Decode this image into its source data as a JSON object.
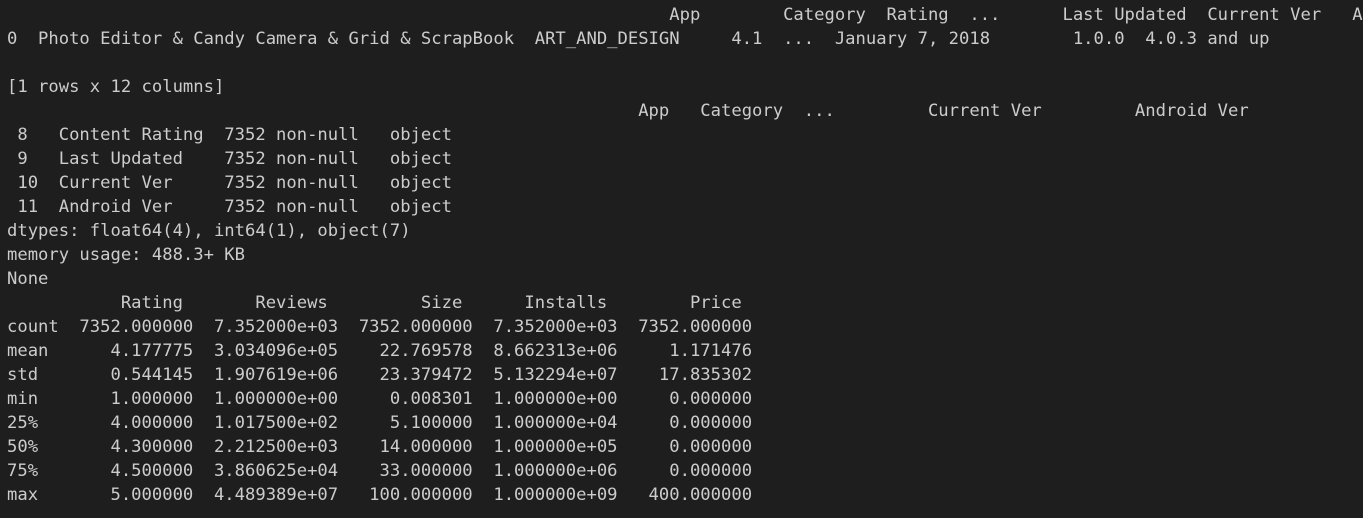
{
  "terminal": {
    "lines": [
      "                                                                App        Category  Rating  ...      Last Updated  Current Ver   Android Ver",
      "0  Photo Editor & Candy Camera & Grid & ScrapBook  ART_AND_DESIGN     4.1  ...  January 7, 2018        1.0.0  4.0.3 and up",
      "",
      "[1 rows x 12 columns]",
      "                                                             App   Category  ...         Current Ver         Android Ver",
      " 8   Content Rating  7352 non-null   object ",
      " 9   Last Updated    7352 non-null   object ",
      " 10  Current Ver     7352 non-null   object ",
      " 11  Android Ver     7352 non-null   object ",
      "dtypes: float64(4), int64(1), object(7)",
      "memory usage: 488.3+ KB",
      "None",
      "           Rating       Reviews         Size      Installs        Price",
      "count  7352.000000  7.352000e+03  7352.000000  7.352000e+03  7352.000000",
      "mean      4.177775  3.034096e+05    22.769578  8.662313e+06     1.171476",
      "std       0.544145  1.907619e+06    23.379472  5.132294e+07    17.835302",
      "min       1.000000  1.000000e+00     0.008301  1.000000e+00     0.000000",
      "25%       4.000000  1.017500e+02     5.100000  1.000000e+04     0.000000",
      "50%       4.300000  2.212500e+03    14.000000  1.000000e+05     0.000000",
      "75%       4.500000  3.860625e+04    33.000000  1.000000e+06     0.000000",
      "max       5.000000  4.489389e+07   100.000000  1.000000e+09   400.000000"
    ]
  }
}
